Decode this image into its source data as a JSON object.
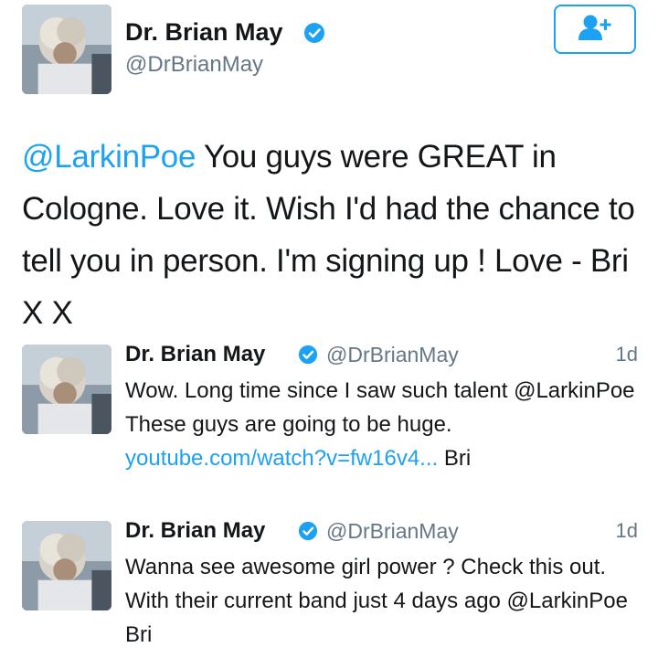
{
  "main_tweet": {
    "name": "Dr. Brian May",
    "handle": "@DrBrianMay",
    "mention": "@LarkinPoe",
    "text": " You guys were GREAT in Cologne.  Love it.  Wish I'd had the chance to tell you in person.   I'm signing up !  Love - Bri X X",
    "follow_icon": "add-user-icon",
    "verified_icon": "verified-badge-icon"
  },
  "replies": [
    {
      "name": "Dr. Brian May",
      "handle": "@DrBrianMay",
      "time": "1d",
      "text_before": "Wow.  Long time since I saw such talent @LarkinPoe  These guys are going to be huge. ",
      "link": "youtube.com/watch?v=fw16v4...",
      "text_after": " Bri"
    },
    {
      "name": "Dr. Brian May",
      "handle": "@DrBrianMay",
      "time": "1d",
      "text": "Wanna see awesome girl power ? Check this out.  With their current band just 4 days ago @LarkinPoe Bri"
    }
  ],
  "colors": {
    "accent": "#1da1f2",
    "secondary_text": "#657786",
    "primary_text": "#14171a"
  }
}
